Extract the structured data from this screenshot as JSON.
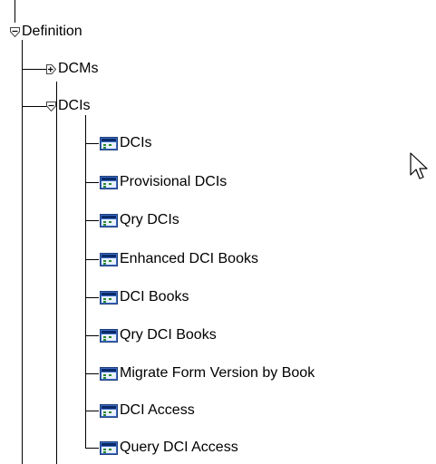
{
  "tree": {
    "root": {
      "label": "Definition",
      "state": "expanded"
    },
    "dcms": {
      "label": "DCMs",
      "state": "collapsed"
    },
    "dcis": {
      "label": "DCIs",
      "state": "expanded"
    },
    "items": [
      {
        "label": "DCIs"
      },
      {
        "label": "Provisional DCIs"
      },
      {
        "label": "Qry DCIs"
      },
      {
        "label": "Enhanced DCI Books"
      },
      {
        "label": "DCI Books"
      },
      {
        "label": "Qry DCI Books"
      },
      {
        "label": "Migrate Form Version by Book"
      },
      {
        "label": "DCI Access"
      },
      {
        "label": "Query DCI Access"
      }
    ]
  },
  "icons": {
    "expanded": "collapse-toggle-icon",
    "collapsed": "expand-toggle-icon",
    "leaf": "form-window-icon",
    "pointer": "mouse-pointer-icon"
  }
}
